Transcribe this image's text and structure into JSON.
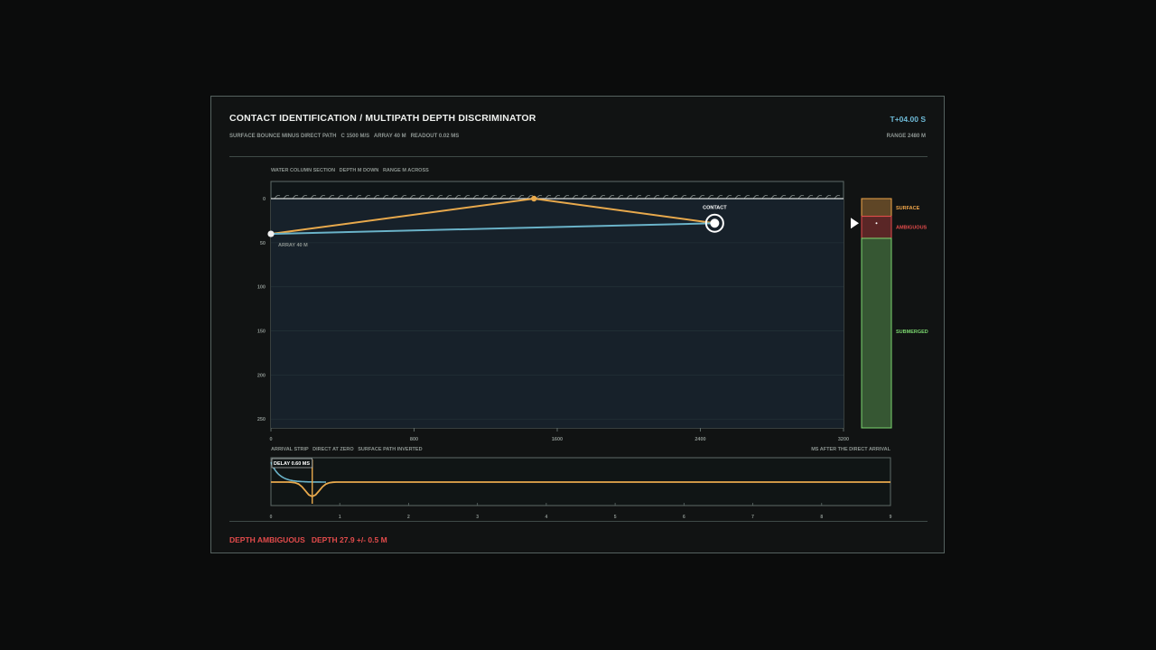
{
  "header": {
    "title": "CONTACT IDENTIFICATION / MULTIPATH DEPTH DISCRIMINATOR",
    "subtitle": "SURFACE BOUNCE MINUS DIRECT PATH   C 1500 M/S   ARRAY 40 M   READOUT 0.02 MS",
    "clock": "T+04.00 S",
    "range": "RANGE 2480 M"
  },
  "section": {
    "label": "WATER COLUMN SECTION   DEPTH M DOWN   RANGE M ACROSS",
    "depth_ticks": [
      "0",
      "50",
      "100",
      "150",
      "200",
      "250"
    ],
    "range_ticks": [
      "0",
      "800",
      "1600",
      "2400",
      "3200"
    ],
    "array_label": "ARRAY 40 M",
    "contact_label": "CONTACT"
  },
  "geometry_data": {
    "array": {
      "range_m": 0,
      "depth_m": 40
    },
    "bounce": {
      "range_m": 1470,
      "depth_m": 0
    },
    "contact": {
      "range_m": 2480,
      "depth_m": 27.9
    },
    "depth_max_m": 260,
    "range_max_m": 3200
  },
  "classifier": {
    "zones": [
      {
        "label": "SURFACE",
        "color": "#f0a64a",
        "from_m": 0,
        "to_m": 20
      },
      {
        "label": "AMBIGUOUS",
        "color": "#e24b4b",
        "from_m": 20,
        "to_m": 45
      },
      {
        "label": "SUBMERGED",
        "color": "#7bd66f",
        "from_m": 45,
        "to_m": 260
      }
    ],
    "marker_depth_m": 27.9
  },
  "arrival": {
    "label": "ARRIVAL STRIP   DIRECT AT ZERO   SURFACE PATH INVERTED",
    "axis_note": "MS AFTER THE DIRECT ARRIVAL",
    "delay_label": "DELAY 0.60 MS",
    "delay_ms": 0.6,
    "ticks": [
      "0",
      "1",
      "2",
      "3",
      "4",
      "5",
      "6",
      "7",
      "8",
      "9"
    ],
    "max_ms": 9
  },
  "status": {
    "text": "DEPTH AMBIGUOUS   DEPTH 27.9 +/- 0.5 M"
  },
  "colors": {
    "direct": "#6ab3c9",
    "surface": "#e8a94c",
    "ambiguous": "#e24b4b",
    "submerged": "#7bd66f"
  }
}
